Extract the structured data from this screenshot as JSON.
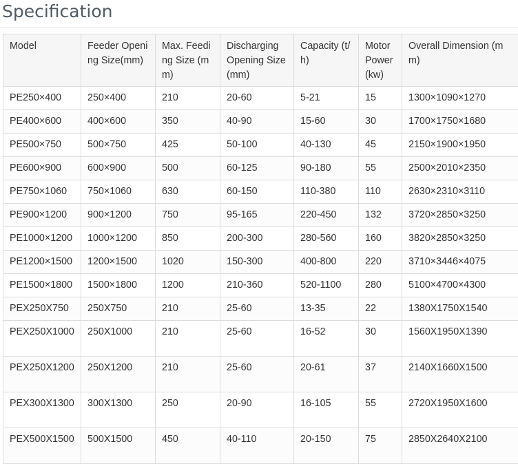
{
  "title": "Specification",
  "table": {
    "headers": [
      "Model",
      "Feeder Opening Size(mm)",
      "Max. Feeding Size (mm)",
      "Discharging Opening Size(mm)",
      "Capacity (t/h)",
      "Motor Power (kw)",
      "Overall Dimension (mm)"
    ],
    "rows": [
      [
        "PE250×400",
        "250×400",
        "210",
        "20-60",
        "5-21",
        "15",
        "1300×1090×1270"
      ],
      [
        "PE400×600",
        "400×600",
        "350",
        "40-90",
        "15-60",
        "30",
        "1700×1750×1680"
      ],
      [
        "PE500×750",
        "500×750",
        "425",
        "50-100",
        "40-130",
        "45",
        "2150×1900×1950"
      ],
      [
        "PE600×900",
        "600×900",
        "500",
        "60-125",
        "90-180",
        "55",
        "2500×2010×2350"
      ],
      [
        "PE750×1060",
        "750×1060",
        "630",
        "60-150",
        "110-380",
        "110",
        "2630×2310×3110"
      ],
      [
        "PE900×1200",
        "900×1200",
        "750",
        "95-165",
        "220-450",
        "132",
        "3720×2850×3250"
      ],
      [
        "PE1000×1200",
        "1000×1200",
        "850",
        "200-300",
        "280-560",
        "160",
        "3820×2850×3250"
      ],
      [
        "PE1200×1500",
        "1200×1500",
        "1020",
        "150-300",
        "400-800",
        "220",
        "3710×3446×4075"
      ],
      [
        "PE1500×1800",
        "1500×1800",
        "1200",
        "210-360",
        "520-1100",
        "280",
        "5100×4700×4300"
      ],
      [
        "PEX250X750",
        "250X750",
        "210",
        "25-60",
        "13-35",
        "22",
        "1380X1750X1540"
      ],
      [
        "PEX250X1000",
        "250X1000",
        "210",
        "25-60",
        "16-52",
        "30",
        "1560X1950X1390"
      ],
      [
        "PEX250X1200",
        "250X1200",
        "210",
        "25-60",
        "20-61",
        "37",
        "2140X1660X1500"
      ],
      [
        "PEX300X1300",
        "300X1300",
        "250",
        "20-90",
        "16-105",
        "55",
        "2720X1950X1600"
      ],
      [
        "PEX500X1500",
        "500X1500",
        "450",
        "40-110",
        "20-150",
        "75",
        "2850X2640X2100"
      ]
    ]
  }
}
